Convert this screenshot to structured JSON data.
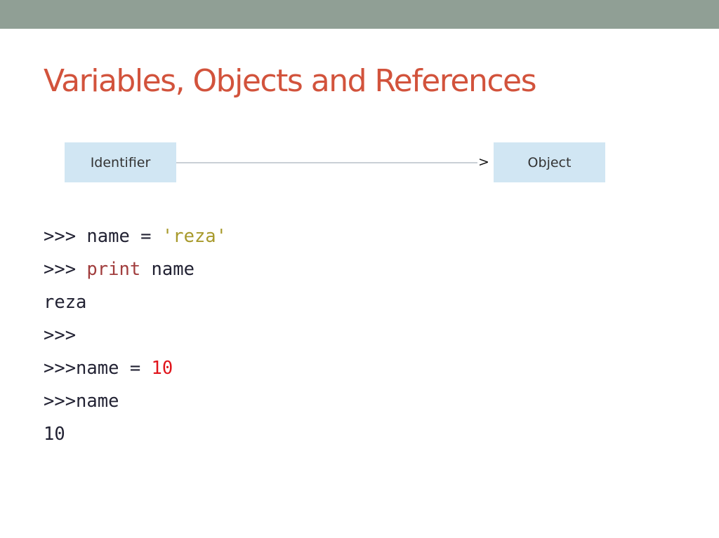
{
  "slide": {
    "title": "Variables, Objects and References"
  },
  "diagram": {
    "identifier_label": "Identifier",
    "object_label": "Object",
    "arrow_glyph": ">"
  },
  "code": {
    "lines": [
      [
        {
          "text": ">>> "
        },
        {
          "text": "name = "
        },
        {
          "text": "'reza'",
          "style": "string"
        }
      ],
      [
        {
          "text": ">>> "
        },
        {
          "text": "print",
          "style": "keyword"
        },
        {
          "text": " name"
        }
      ],
      [
        {
          "text": "reza"
        }
      ],
      [
        {
          "text": ">>>"
        }
      ],
      [
        {
          "text": ">>>name = "
        },
        {
          "text": "10",
          "style": "number"
        }
      ],
      [
        {
          "text": ">>>name"
        }
      ],
      [
        {
          "text": "10"
        }
      ]
    ]
  },
  "colors": {
    "top_bar": "#909f95",
    "title": "#d2533c",
    "box_fill": "#d1e6f3",
    "string": "#a89a2c",
    "keyword": "#a13d3d",
    "number": "#e0141b"
  }
}
